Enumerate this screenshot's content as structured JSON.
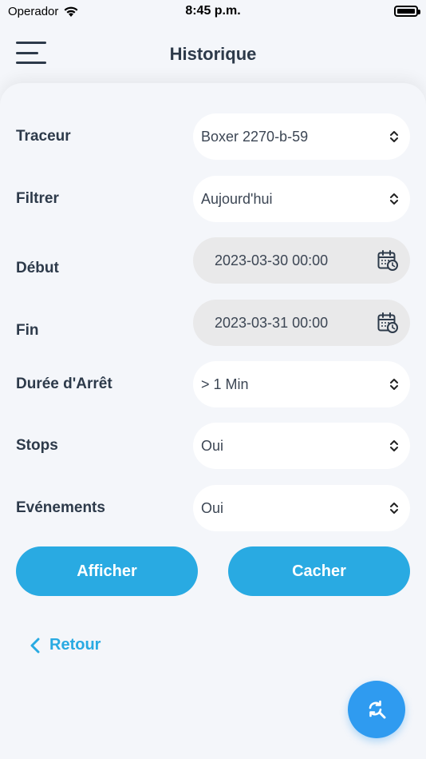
{
  "status": {
    "carrier": "Operador",
    "time": "8:45 p.m."
  },
  "header": {
    "title": "Historique"
  },
  "form": {
    "traceur": {
      "label": "Traceur",
      "value": "Boxer 2270-b-59"
    },
    "filtrer": {
      "label": "Filtrer",
      "value": "Aujourd'hui"
    },
    "debut": {
      "label": "Début",
      "value": "2023-03-30 00:00"
    },
    "fin": {
      "label": "Fin",
      "value": "2023-03-31 00:00"
    },
    "duree": {
      "label": "Durée d'Arrêt",
      "value": "> 1 Min"
    },
    "stops": {
      "label": "Stops",
      "value": "Oui"
    },
    "evenements": {
      "label": "Evénements",
      "value": "Oui"
    }
  },
  "actions": {
    "show_label": "Afficher",
    "hide_label": "Cacher",
    "back_label": "Retour"
  },
  "colors": {
    "accent": "#29aae2",
    "fab": "#2f9bf0",
    "text": "#2d3a4a"
  }
}
